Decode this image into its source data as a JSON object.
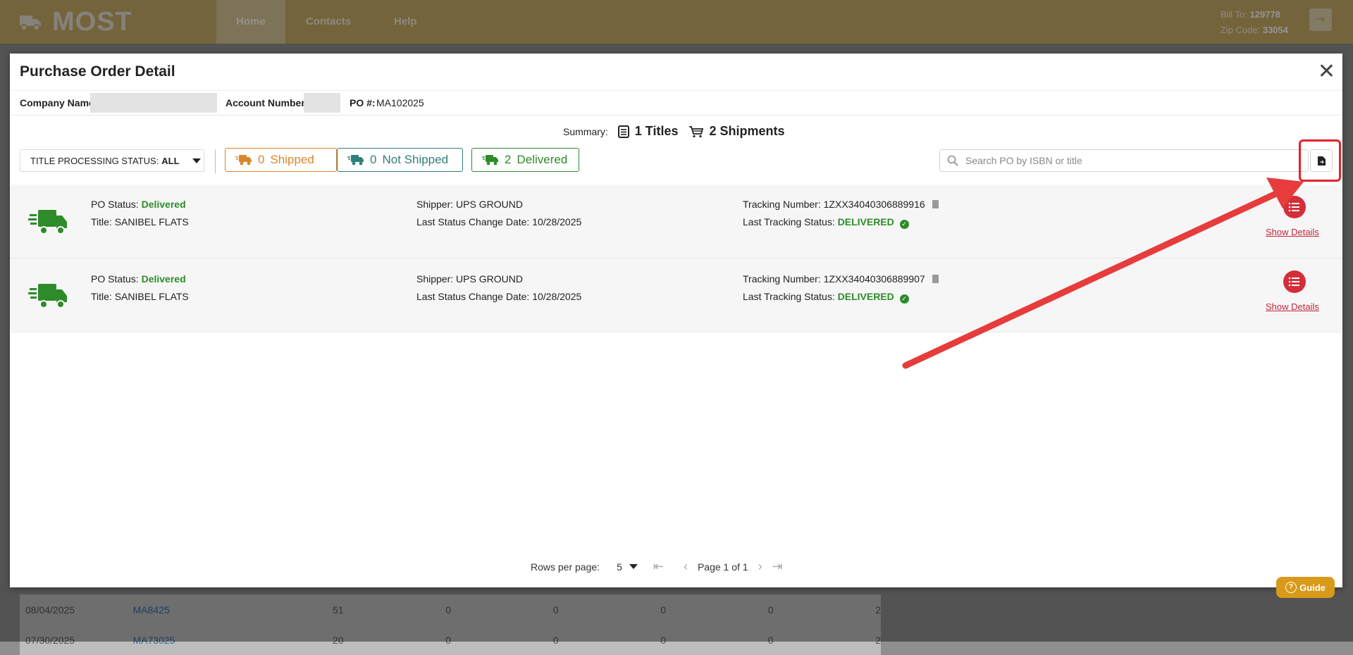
{
  "app": {
    "logo_text": "MOST"
  },
  "nav": {
    "items": [
      {
        "label": "Home"
      },
      {
        "label": "Contacts"
      },
      {
        "label": "Help"
      }
    ]
  },
  "account": {
    "bill_to_label": "Bill To:",
    "bill_to": "129778",
    "zip_label": "Zip Code:",
    "zip": "33054"
  },
  "background_table": {
    "rows": [
      {
        "date": "08/04/2025",
        "po": "MA8425",
        "c1": "51",
        "c2": "0",
        "c3": "0",
        "c4": "0",
        "c5": "0",
        "c6": "2"
      },
      {
        "date": "07/30/2025",
        "po": "MA73025",
        "c1": "20",
        "c2": "0",
        "c3": "0",
        "c4": "0",
        "c5": "0",
        "c6": "2"
      }
    ]
  },
  "modal": {
    "title": "Purchase Order Detail",
    "company_label": "Company Name",
    "account_label": "Account Number:",
    "po_label": "PO #:",
    "po_number": "MA102025",
    "summary_label": "Summary:",
    "titles_text": "1 Titles",
    "shipments_text": "2 Shipments",
    "filter_label": "TITLE PROCESSING STATUS:",
    "filter_value": "ALL",
    "chips": {
      "shipped_count": "0",
      "shipped_label": "Shipped",
      "not_shipped_count": "0",
      "not_shipped_label": "Not Shipped",
      "delivered_count": "2",
      "delivered_label": "Delivered"
    },
    "search_placeholder": "Search PO by ISBN or title",
    "rows": [
      {
        "po_status_label": "PO Status:",
        "po_status": "Delivered",
        "title_label": "Title:",
        "title": "SANIBEL FLATS",
        "shipper_label": "Shipper:",
        "shipper": "UPS GROUND",
        "last_change_label": "Last Status Change Date:",
        "last_change": "10/28/2025",
        "tracking_label": "Tracking Number:",
        "tracking": "1ZXX34040306889916",
        "tracking_status_label": "Last Tracking Status:",
        "tracking_status": "DELIVERED",
        "show_details": "Show Details"
      },
      {
        "po_status_label": "PO Status:",
        "po_status": "Delivered",
        "title_label": "Title:",
        "title": "SANIBEL FLATS",
        "shipper_label": "Shipper:",
        "shipper": "UPS GROUND",
        "last_change_label": "Last Status Change Date:",
        "last_change": "10/28/2025",
        "tracking_label": "Tracking Number:",
        "tracking": "1ZXX34040306889907",
        "tracking_status_label": "Last Tracking Status:",
        "tracking_status": "DELIVERED",
        "show_details": "Show Details"
      }
    ],
    "pagination": {
      "rows_per_page_label": "Rows per page:",
      "rows_per_page": "5",
      "page_text": "Page 1 of 1"
    }
  },
  "guide_label": "Guide",
  "colors": {
    "brand": "#c8ad66",
    "shipped": "#d8872c",
    "not_shipped": "#2f7f7b",
    "delivered": "#2e8b2a",
    "detail_red": "#d42e3a",
    "annotation_red": "#e0242a"
  }
}
